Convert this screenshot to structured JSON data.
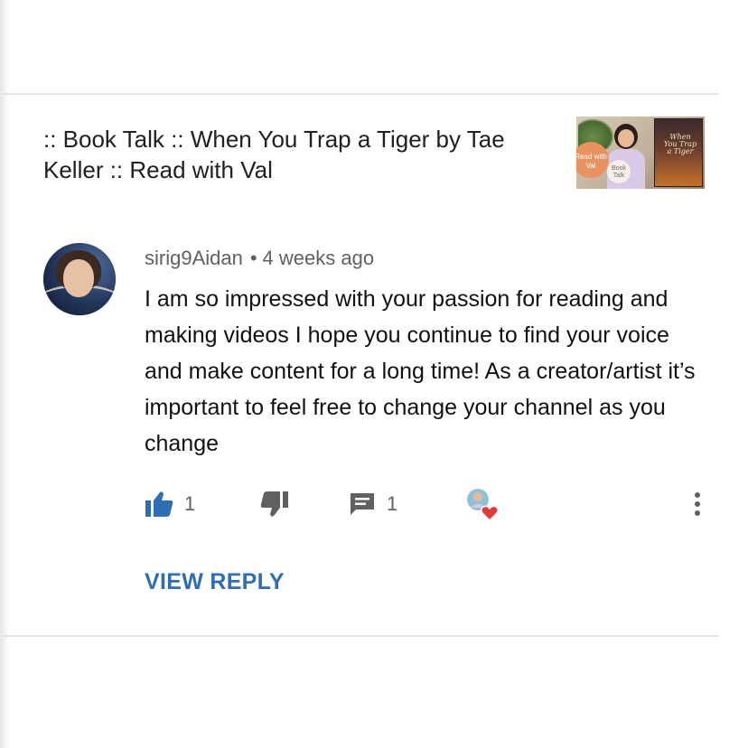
{
  "video": {
    "title": ":: Book Talk :: When You Trap a Tiger by Tae Keller :: Read with Val",
    "thumbnail": {
      "read_badge": "Read with Val",
      "talk_badge": "Book Talk",
      "book_title": "When You Trap a Tiger"
    }
  },
  "comment": {
    "author": "sirig9Aidan",
    "separator": "•",
    "time": "4 weeks ago",
    "text": "I am so impressed with your passion for reading and making videos I hope you continue to find your voice and make content for a long time! As a creator/artist it’s important to feel free to change your channel as you change",
    "likes": "1",
    "replies": "1",
    "view_reply_label": "VIEW REPLY"
  },
  "icons": {
    "like": "thumbs-up-icon",
    "dislike": "thumbs-down-icon",
    "reply": "comment-icon",
    "creator_heart": "creator-heart-icon",
    "more": "more-vert-icon"
  },
  "colors": {
    "accent_blue": "#2f6eb4",
    "like_active": "#2f6eb4",
    "heart_red": "#e53935",
    "secondary_text": "#606060",
    "divider": "#e3e3e3"
  }
}
